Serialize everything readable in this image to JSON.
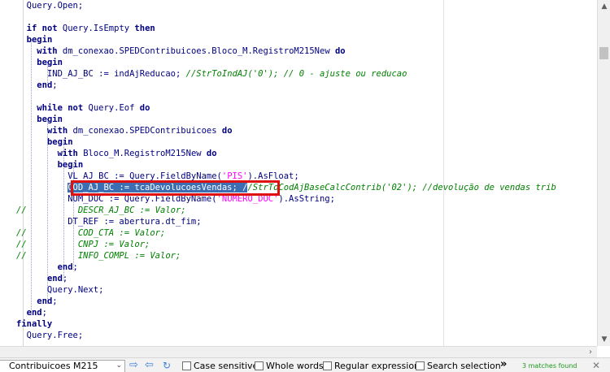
{
  "editor": {
    "lines": [
      [
        {
          "t": "  Query.Open;",
          "c": "id"
        }
      ],
      [
        {
          "t": "",
          "c": "id"
        }
      ],
      [
        {
          "t": "  ",
          "c": "id"
        },
        {
          "t": "if not",
          "c": "kw"
        },
        {
          "t": " Query.IsEmpty ",
          "c": "id"
        },
        {
          "t": "then",
          "c": "kw"
        }
      ],
      [
        {
          "t": "  ",
          "c": "id"
        },
        {
          "t": "begin",
          "c": "kw"
        }
      ],
      [
        {
          "t": "    ",
          "c": "id"
        },
        {
          "t": "with",
          "c": "kw"
        },
        {
          "t": " dm_conexao.SPEDContribuicoes.Bloco_M.RegistroM215New ",
          "c": "id"
        },
        {
          "t": "do",
          "c": "kw"
        }
      ],
      [
        {
          "t": "    ",
          "c": "id"
        },
        {
          "t": "begin",
          "c": "kw"
        }
      ],
      [
        {
          "t": "      IND_AJ_BC := indAjReducao; ",
          "c": "id"
        },
        {
          "t": "//StrToIndAJ('0'); // 0 - ajuste ou reducao",
          "c": "cm"
        }
      ],
      [
        {
          "t": "    ",
          "c": "id"
        },
        {
          "t": "end",
          "c": "kw"
        },
        {
          "t": ";",
          "c": "id"
        }
      ],
      [
        {
          "t": "",
          "c": "id"
        }
      ],
      [
        {
          "t": "    ",
          "c": "id"
        },
        {
          "t": "while not",
          "c": "kw"
        },
        {
          "t": " Query.Eof ",
          "c": "id"
        },
        {
          "t": "do",
          "c": "kw"
        }
      ],
      [
        {
          "t": "    ",
          "c": "id"
        },
        {
          "t": "begin",
          "c": "kw"
        }
      ],
      [
        {
          "t": "      ",
          "c": "id"
        },
        {
          "t": "with",
          "c": "kw"
        },
        {
          "t": " dm_conexao.SPEDContribuicoes ",
          "c": "id"
        },
        {
          "t": "do",
          "c": "kw"
        }
      ],
      [
        {
          "t": "      ",
          "c": "id"
        },
        {
          "t": "begin",
          "c": "kw"
        }
      ],
      [
        {
          "t": "        ",
          "c": "id"
        },
        {
          "t": "with",
          "c": "kw"
        },
        {
          "t": " Bloco_M.RegistroM215New ",
          "c": "id"
        },
        {
          "t": "do",
          "c": "kw"
        }
      ],
      [
        {
          "t": "        ",
          "c": "id"
        },
        {
          "t": "begin",
          "c": "kw"
        }
      ],
      [
        {
          "t": "          VL_AJ_BC := Query.FieldByName(",
          "c": "id"
        },
        {
          "t": "'PIS'",
          "c": "st"
        },
        {
          "t": ").AsFloat;",
          "c": "id"
        }
      ],
      [
        {
          "t": "          ",
          "c": "id"
        },
        {
          "t": "COD_AJ_BC := tcaDevolucoesVendas; ",
          "c": "sel"
        },
        {
          "t": "/",
          "c": "sel"
        },
        {
          "t": "/StrToCodAjBaseCalcContrib('02'); //devolução de vendas trib",
          "c": "cm"
        }
      ],
      [
        {
          "t": "          NUM_DOC := Query.FieldByName(",
          "c": "id"
        },
        {
          "t": "'NUMERO_DOC'",
          "c": "st"
        },
        {
          "t": ").AsString;",
          "c": "id"
        }
      ],
      [
        {
          "t": "//          DESCR_AJ_BC := Valor;",
          "c": "cm"
        }
      ],
      [
        {
          "t": "          DT_REF := abertura.dt_fim;",
          "c": "id"
        }
      ],
      [
        {
          "t": "//          COD_CTA := Valor;",
          "c": "cm"
        }
      ],
      [
        {
          "t": "//          CNPJ := Valor;",
          "c": "cm"
        }
      ],
      [
        {
          "t": "//          INFO_COMPL := Valor;",
          "c": "cm"
        }
      ],
      [
        {
          "t": "        ",
          "c": "id"
        },
        {
          "t": "end",
          "c": "kw"
        },
        {
          "t": ";",
          "c": "id"
        }
      ],
      [
        {
          "t": "      ",
          "c": "id"
        },
        {
          "t": "end",
          "c": "kw"
        },
        {
          "t": ";",
          "c": "id"
        }
      ],
      [
        {
          "t": "      Query.Next;",
          "c": "id"
        }
      ],
      [
        {
          "t": "    ",
          "c": "id"
        },
        {
          "t": "end",
          "c": "kw"
        },
        {
          "t": ";",
          "c": "id"
        }
      ],
      [
        {
          "t": "  ",
          "c": "id"
        },
        {
          "t": "end",
          "c": "kw"
        },
        {
          "t": ";",
          "c": "id"
        }
      ],
      [
        {
          "t": "finally",
          "c": "kw"
        }
      ],
      [
        {
          "t": "  Query.Free;",
          "c": "id"
        }
      ],
      [
        {
          "t": "  ",
          "c": "id"
        }
      ]
    ]
  },
  "findbar": {
    "search_value": "Contribuicoes M215",
    "options": [
      {
        "label": "Case sensitive",
        "checked": false
      },
      {
        "label": "Whole words",
        "checked": false
      },
      {
        "label": "Regular expression",
        "checked": false
      },
      {
        "label": "Search selection",
        "checked": false
      }
    ],
    "more": "»",
    "matches_text": "3 matches found",
    "close": "✕"
  },
  "colors": {
    "keyword": "#000080",
    "comment": "#008000",
    "string": "#ff00ff",
    "selection": "#3c6eb4",
    "highlight_box": "#e01010",
    "matches": "#1a9a1a"
  },
  "icons": {
    "find_next": "arrow-right-icon",
    "find_previous": "arrow-left-icon",
    "refresh": "refresh-icon",
    "combo": "chevron-down-icon",
    "close": "close-icon"
  }
}
